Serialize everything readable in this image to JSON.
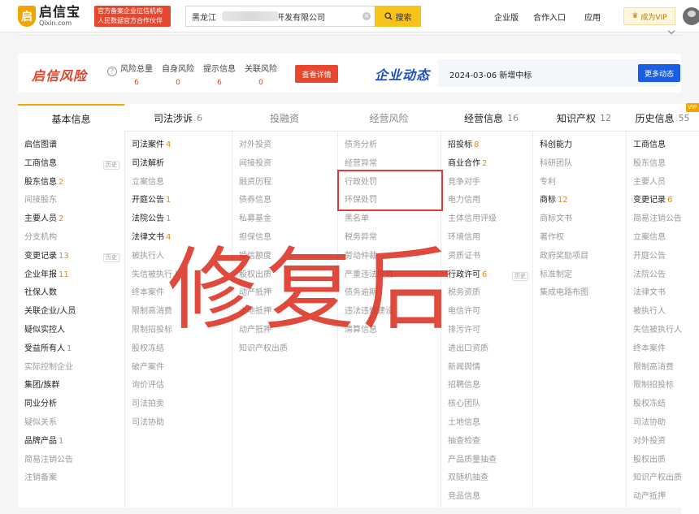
{
  "header": {
    "logo_icon_text": "启",
    "logo_cn": "启信宝",
    "logo_en": "Qixin.com",
    "badge_line1": "官方备案企业征信机构",
    "badge_line2": "人民数据官方合作伙伴",
    "search_value_prefix": "黑龙江",
    "search_value_suffix": "开发有限公司",
    "search_button": "搜索",
    "nav": [
      "企业版",
      "合作入口",
      "应用"
    ],
    "vip_button": "成为VIP"
  },
  "risk": {
    "logo": "启信风险",
    "help_icon": "?",
    "stats": [
      {
        "label": "风险总量",
        "value": "6"
      },
      {
        "label": "自身风险",
        "value": "0"
      },
      {
        "label": "提示信息",
        "value": "6"
      },
      {
        "label": "关联风险",
        "value": "0"
      }
    ],
    "detail_button": "查看详情"
  },
  "dynamics": {
    "logo": "企业动态",
    "text": "2024-03-06 新增中标",
    "more_button": "更多动态"
  },
  "tabs": [
    {
      "label": "基本信息",
      "count": "",
      "state": "active"
    },
    {
      "label": "司法涉诉",
      "count": "6",
      "state": "normal"
    },
    {
      "label": "投融资",
      "count": "",
      "state": "muted"
    },
    {
      "label": "经营风险",
      "count": "",
      "state": "muted"
    },
    {
      "label": "经营信息",
      "count": "16",
      "state": "normal"
    },
    {
      "label": "知识产权",
      "count": "12",
      "state": "normal"
    },
    {
      "label": "历史信息",
      "count": "55",
      "state": "normal"
    }
  ],
  "vip_corner": "VIP",
  "history_tag": "历史",
  "watermark": "修复后",
  "columns": [
    [
      {
        "label": "启信图谱",
        "count": "",
        "on": true
      },
      {
        "label": "工商信息",
        "count": "",
        "on": true,
        "tag": true
      },
      {
        "label": "股东信息",
        "count": "2",
        "on": true
      },
      {
        "label": "间接股东",
        "count": "",
        "on": false
      },
      {
        "label": "主要人员",
        "count": "2",
        "on": true
      },
      {
        "label": "分支机构",
        "count": "",
        "on": false
      },
      {
        "label": "变更记录",
        "count": "13",
        "on": true,
        "tag": true
      },
      {
        "label": "企业年报",
        "count": "11",
        "on": true
      },
      {
        "label": "社保人数",
        "count": "",
        "on": true
      },
      {
        "label": "关联企业/人员",
        "count": "",
        "on": true
      },
      {
        "label": "疑似实控人",
        "count": "",
        "on": true
      },
      {
        "label": "受益所有人",
        "count": "1",
        "on": true
      },
      {
        "label": "实际控制企业",
        "count": "",
        "on": false
      },
      {
        "label": "集团/族群",
        "count": "",
        "on": true
      },
      {
        "label": "同业分析",
        "count": "",
        "on": true
      },
      {
        "label": "疑似关系",
        "count": "",
        "on": false
      },
      {
        "label": "品牌产品",
        "count": "1",
        "on": true
      },
      {
        "label": "简易注销公告",
        "count": "",
        "on": false
      },
      {
        "label": "注销备案",
        "count": "",
        "on": false
      }
    ],
    [
      {
        "label": "司法案件",
        "count": "4",
        "on": true
      },
      {
        "label": "司法解析",
        "count": "",
        "on": true
      },
      {
        "label": "立案信息",
        "count": "",
        "on": false
      },
      {
        "label": "开庭公告",
        "count": "1",
        "on": true
      },
      {
        "label": "法院公告",
        "count": "1",
        "on": true
      },
      {
        "label": "法律文书",
        "count": "4",
        "on": true
      },
      {
        "label": "被执行人",
        "count": "",
        "on": false
      },
      {
        "label": "失信被执行人",
        "count": "",
        "on": false
      },
      {
        "label": "终本案件",
        "count": "",
        "on": false
      },
      {
        "label": "限制高消费",
        "count": "",
        "on": false
      },
      {
        "label": "限制招投标",
        "count": "",
        "on": false
      },
      {
        "label": "股权冻结",
        "count": "",
        "on": false
      },
      {
        "label": "破产案件",
        "count": "",
        "on": false
      },
      {
        "label": "询价评估",
        "count": "",
        "on": false
      },
      {
        "label": "司法拍卖",
        "count": "",
        "on": false
      },
      {
        "label": "司法协助",
        "count": "",
        "on": false
      }
    ],
    [
      {
        "label": "对外投资",
        "count": "",
        "on": false
      },
      {
        "label": "间接投资",
        "count": "",
        "on": false
      },
      {
        "label": "融资历程",
        "count": "",
        "on": false
      },
      {
        "label": "债券信息",
        "count": "",
        "on": false
      },
      {
        "label": "私募基金",
        "count": "",
        "on": false
      },
      {
        "label": "担保信息",
        "count": "",
        "on": false
      },
      {
        "label": "授信额度",
        "count": "",
        "on": false
      },
      {
        "label": "股权出质",
        "count": "",
        "on": false
      },
      {
        "label": "动产抵押",
        "count": "",
        "on": false
      },
      {
        "label": "土地抵押",
        "count": "",
        "on": false
      },
      {
        "label": "动产抵押",
        "count": "",
        "on": false
      },
      {
        "label": "知识产权出质",
        "count": "",
        "on": false
      }
    ],
    [
      {
        "label": "债务分析",
        "count": "",
        "on": false
      },
      {
        "label": "经营异常",
        "count": "",
        "on": false
      },
      {
        "label": "行政处罚",
        "count": "",
        "on": false
      },
      {
        "label": "环保处罚",
        "count": "",
        "on": false
      },
      {
        "label": "黑名单",
        "count": "",
        "on": false
      },
      {
        "label": "税务异常",
        "count": "",
        "on": false
      },
      {
        "label": "劳动仲裁",
        "count": "",
        "on": false
      },
      {
        "label": "严重违法失信",
        "count": "",
        "on": false
      },
      {
        "label": "债务逾期",
        "count": "",
        "on": false
      },
      {
        "label": "违法违规建设",
        "count": "",
        "on": false
      },
      {
        "label": "清算信息",
        "count": "",
        "on": false
      }
    ],
    [
      {
        "label": "招投标",
        "count": "8",
        "on": true
      },
      {
        "label": "商业合作",
        "count": "2",
        "on": true
      },
      {
        "label": "竞争对手",
        "count": "",
        "on": false
      },
      {
        "label": "电力信用",
        "count": "",
        "on": false
      },
      {
        "label": "主体信用评级",
        "count": "",
        "on": false
      },
      {
        "label": "环境信用",
        "count": "",
        "on": false
      },
      {
        "label": "资质证书",
        "count": "",
        "on": false
      },
      {
        "label": "行政许可",
        "count": "6",
        "on": true,
        "tag": true
      },
      {
        "label": "税务资质",
        "count": "",
        "on": false
      },
      {
        "label": "电信许可",
        "count": "",
        "on": false
      },
      {
        "label": "排污许可",
        "count": "",
        "on": false
      },
      {
        "label": "进出口资质",
        "count": "",
        "on": false
      },
      {
        "label": "新闻舆情",
        "count": "",
        "on": false
      },
      {
        "label": "招聘信息",
        "count": "",
        "on": false
      },
      {
        "label": "核心团队",
        "count": "",
        "on": false
      },
      {
        "label": "土地信息",
        "count": "",
        "on": false
      },
      {
        "label": "抽查检查",
        "count": "",
        "on": false
      },
      {
        "label": "产品质量抽查",
        "count": "",
        "on": false
      },
      {
        "label": "双随机抽查",
        "count": "",
        "on": false
      },
      {
        "label": "竞品信息",
        "count": "",
        "on": false
      }
    ],
    [
      {
        "label": "科创能力",
        "count": "",
        "on": true
      },
      {
        "label": "科研团队",
        "count": "",
        "on": false
      },
      {
        "label": "专利",
        "count": "",
        "on": false
      },
      {
        "label": "商标",
        "count": "12",
        "on": true
      },
      {
        "label": "商标文书",
        "count": "",
        "on": false
      },
      {
        "label": "著作权",
        "count": "",
        "on": false
      },
      {
        "label": "政府奖励项目",
        "count": "",
        "on": false
      },
      {
        "label": "标准制定",
        "count": "",
        "on": false
      },
      {
        "label": "集成电路布图",
        "count": "",
        "on": false
      }
    ],
    [
      {
        "label": "工商信息",
        "count": "",
        "on": true
      },
      {
        "label": "股东信息",
        "count": "",
        "on": false
      },
      {
        "label": "主要人员",
        "count": "",
        "on": false
      },
      {
        "label": "变更记录",
        "count": "6",
        "on": true
      },
      {
        "label": "简易注销公告",
        "count": "",
        "on": false
      },
      {
        "label": "立案信息",
        "count": "",
        "on": false
      },
      {
        "label": "开庭公告",
        "count": "",
        "on": false
      },
      {
        "label": "法院公告",
        "count": "",
        "on": false
      },
      {
        "label": "法律文书",
        "count": "",
        "on": false
      },
      {
        "label": "被执行人",
        "count": "",
        "on": false
      },
      {
        "label": "失信被执行人",
        "count": "",
        "on": false
      },
      {
        "label": "终本案件",
        "count": "",
        "on": false
      },
      {
        "label": "限制高消费",
        "count": "",
        "on": false
      },
      {
        "label": "限制招投标",
        "count": "",
        "on": false
      },
      {
        "label": "股权冻结",
        "count": "",
        "on": false
      },
      {
        "label": "司法协助",
        "count": "",
        "on": false
      },
      {
        "label": "对外投资",
        "count": "",
        "on": false
      },
      {
        "label": "股权出质",
        "count": "",
        "on": false
      },
      {
        "label": "知识产权出质",
        "count": "",
        "on": false
      },
      {
        "label": "动产抵押",
        "count": "",
        "on": false
      }
    ]
  ],
  "colors": {
    "brand_orange": "#f2a400",
    "risk_red": "#e0432a",
    "link_blue": "#1a5ee6",
    "highlight_red": "#e03a3a"
  }
}
